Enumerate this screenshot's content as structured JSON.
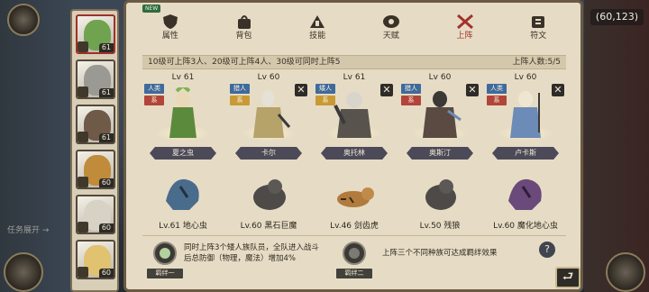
{
  "coord": "(60,123)",
  "left_hint": "任务展开 →",
  "portraits": [
    {
      "lv": "61",
      "color": "#6fa34f",
      "selected": true
    },
    {
      "lv": "61",
      "color": "#9b9994",
      "selected": false
    },
    {
      "lv": "61",
      "color": "#6e5a47",
      "selected": false
    },
    {
      "lv": "60",
      "color": "#c08b3a",
      "selected": false
    },
    {
      "lv": "60",
      "color": "#d8d2c4",
      "selected": false
    },
    {
      "lv": "60",
      "color": "#e0c270",
      "selected": false
    }
  ],
  "tabs": [
    {
      "label": "属性",
      "icon": "shield-icon",
      "badge": "NEW"
    },
    {
      "label": "背包",
      "icon": "bag-icon"
    },
    {
      "label": "技能",
      "icon": "skill-icon"
    },
    {
      "label": "天赋",
      "icon": "talent-icon"
    },
    {
      "label": "上阵",
      "icon": "swords-icon",
      "active": true
    },
    {
      "label": "符文",
      "icon": "rune-icon"
    }
  ],
  "infobar": {
    "rule": "10级可上阵3人、20级可上阵4人、30级可同时上阵5",
    "count": "上阵人数:5/5"
  },
  "heroes": [
    {
      "lv": "Lv 61",
      "tags": [
        {
          "text": "人类",
          "color": "#3f6a9c"
        },
        {
          "text": "系",
          "color": "#b2453a"
        }
      ],
      "name": "夏之虫",
      "removable": false,
      "color": "#5c8a3c"
    },
    {
      "lv": "Lv 60",
      "tags": [
        {
          "text": "猎人",
          "color": "#3f6a9c"
        },
        {
          "text": "系",
          "color": "#c89a36"
        }
      ],
      "name": "卡尔",
      "removable": true,
      "color": "#b5a36a"
    },
    {
      "lv": "Lv 61",
      "tags": [
        {
          "text": "矮人",
          "color": "#3f6a9c"
        },
        {
          "text": "系",
          "color": "#c89a36"
        }
      ],
      "name": "奥托林",
      "removable": true,
      "color": "#9d9891"
    },
    {
      "lv": "Lv 60",
      "tags": [
        {
          "text": "猎人",
          "color": "#3f6a9c"
        },
        {
          "text": "系",
          "color": "#b2453a"
        }
      ],
      "name": "奥斯汀",
      "removable": true,
      "color": "#5a4a42"
    },
    {
      "lv": "Lv 60",
      "tags": [
        {
          "text": "人类",
          "color": "#3f6a9c"
        },
        {
          "text": "系",
          "color": "#b2453a"
        }
      ],
      "name": "卢卡斯",
      "removable": true,
      "color": "#6c8bb6"
    }
  ],
  "pets": [
    {
      "name": "Lv.61 地心虫",
      "color": "#4a6c8c"
    },
    {
      "name": "Lv.60 黑石巨魔",
      "color": "#4d4a48"
    },
    {
      "name": "Lv.46 剑齿虎",
      "color": "#b07b3d"
    },
    {
      "name": "Lv.50 残狼",
      "color": "#4d4a48"
    },
    {
      "name": "Lv.60 魔化地心虫",
      "color": "#6a4a7a"
    }
  ],
  "bonds": [
    {
      "tag": "羁绊一",
      "text_line1": "同时上阵3个矮人族队员，全队进入战斗",
      "text_line2": "后总防御（物理，魔法）增加4%"
    },
    {
      "tag": "羁绊二",
      "text_line1": "上阵三个不同种族可达成羁绊效果"
    }
  ],
  "help_label": "?",
  "back_label": "⮐"
}
